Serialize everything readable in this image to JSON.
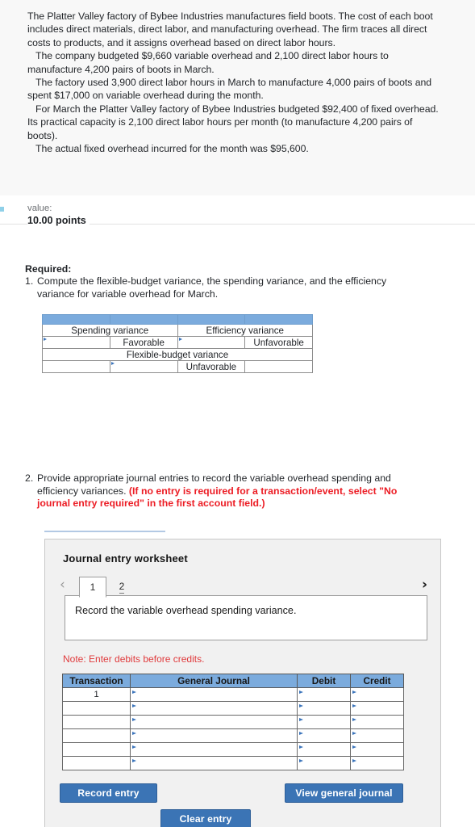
{
  "problem": {
    "paragraphs": [
      "The Platter Valley factory of Bybee Industries manufactures field boots. The cost of each boot includes direct materials, direct labor, and manufacturing overhead. The firm traces all direct costs to products, and it assigns overhead based on direct labor hours.",
      "The company budgeted $9,660 variable overhead and 2,100 direct labor hours to manufacture 4,200 pairs of boots in March.",
      "The factory used 3,900 direct labor hours in March to manufacture 4,000 pairs of boots and spent $17,000 on variable overhead during the month.",
      "For March the Platter Valley factory of Bybee Industries budgeted $92,400 of fixed overhead. Its practical capacity is 2,100 direct labor hours per month (to manufacture 4,200 pairs of boots).",
      "The actual fixed overhead incurred for the month was $95,600."
    ]
  },
  "value_strip": {
    "label": "value:",
    "points": "10.00 points"
  },
  "required": {
    "heading": "Required:",
    "item1": {
      "number": "1.",
      "text": "Compute the flexible-budget variance, the spending variance, and the efficiency variance for variable overhead for March."
    },
    "item2": {
      "number": "2.",
      "text": "Provide appropriate journal entries to record the variable overhead spending and efficiency variances. ",
      "red_text": "(If no entry is required for a transaction/event, select \"No journal entry required\" in the first account field.)"
    }
  },
  "variance_table": {
    "header_color": "#7babdd",
    "rows": [
      {
        "type": "header",
        "cells": [
          "",
          "",
          "",
          ""
        ]
      },
      {
        "type": "label",
        "cells": [
          "Spending variance",
          "Efficiency variance"
        ]
      },
      {
        "type": "input",
        "cells": [
          "",
          "Favorable",
          "",
          "Unfavorable"
        ]
      },
      {
        "type": "label-wide",
        "cells": [
          "Flexible-budget variance"
        ]
      },
      {
        "type": "input2",
        "cells": [
          "",
          "",
          "Unfavorable",
          ""
        ]
      }
    ]
  },
  "journal_panel": {
    "title": "Journal entry worksheet",
    "tabs": [
      {
        "label": "1",
        "active": true
      },
      {
        "label": "2",
        "active": false
      }
    ],
    "nav_prev_icon": "chevron-left-icon",
    "nav_next_icon": "chevron-right-icon",
    "prompt": "Record the variable overhead spending variance.",
    "note": "Note: Enter debits before credits.",
    "table": {
      "headers": [
        "Transaction",
        "General Journal",
        "Debit",
        "Credit"
      ],
      "rows": [
        {
          "transaction": "1",
          "general_journal": "",
          "debit": "",
          "credit": ""
        },
        {
          "transaction": "",
          "general_journal": "",
          "debit": "",
          "credit": ""
        },
        {
          "transaction": "",
          "general_journal": "",
          "debit": "",
          "credit": ""
        },
        {
          "transaction": "",
          "general_journal": "",
          "debit": "",
          "credit": ""
        },
        {
          "transaction": "",
          "general_journal": "",
          "debit": "",
          "credit": ""
        },
        {
          "transaction": "",
          "general_journal": "",
          "debit": "",
          "credit": ""
        }
      ]
    },
    "buttons": {
      "record": "Record entry",
      "clear": "Clear entry",
      "view": "View general journal",
      "color": "#3b74b5"
    }
  }
}
